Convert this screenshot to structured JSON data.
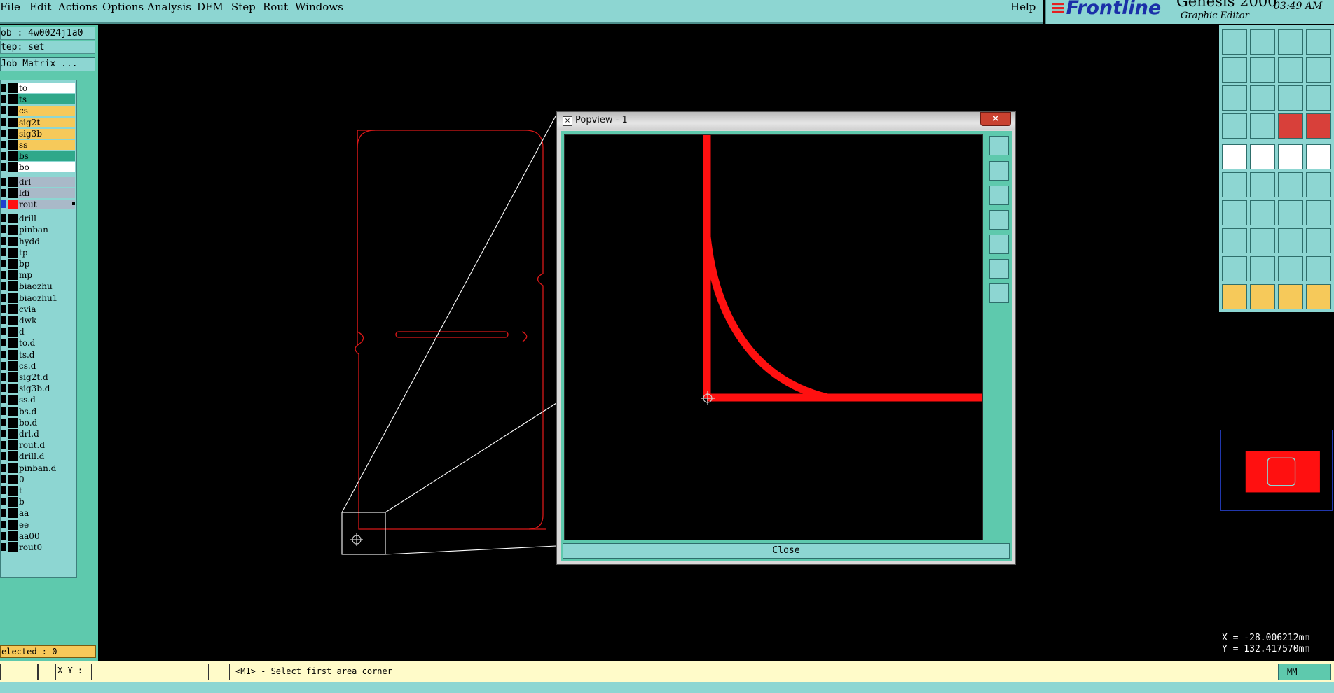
{
  "menu": {
    "items": [
      "File",
      "Edit",
      "Actions",
      "Options",
      "Analysis",
      "DFM",
      "Step",
      "Rout",
      "Windows"
    ],
    "help": "Help"
  },
  "brand": {
    "logo": "Frontline",
    "product": "Genesis 2000",
    "subtitle": "Graphic Editor",
    "clock": "03:49 AM"
  },
  "left_panel": {
    "job": "ob : 4w0024j1a0",
    "step": "tep: set",
    "matrix_button": "Job Matrix ...",
    "selected": "elected : 0"
  },
  "layers": [
    {
      "name": "to",
      "color": "#ffffff"
    },
    {
      "name": "ts",
      "color": "#2fa88a"
    },
    {
      "name": "cs",
      "color": "#f6c95a"
    },
    {
      "name": "sig2t",
      "color": "#f6c95a"
    },
    {
      "name": "sig3b",
      "color": "#f6c95a"
    },
    {
      "name": "ss",
      "color": "#f6c95a"
    },
    {
      "name": "bs",
      "color": "#2fa88a"
    },
    {
      "name": "bo",
      "color": "#ffffff"
    },
    {
      "name": "drl",
      "color": "#a9b9c8"
    },
    {
      "name": "ldi",
      "color": "#a9b9c8"
    },
    {
      "name": "rout",
      "color": "#a9b9c8",
      "active": true
    },
    {
      "name": "drill",
      "color": "#8dd6d2"
    },
    {
      "name": "pinban",
      "color": "#8dd6d2"
    },
    {
      "name": "hydd",
      "color": "#8dd6d2"
    },
    {
      "name": "tp",
      "color": "#8dd6d2"
    },
    {
      "name": "bp",
      "color": "#8dd6d2"
    },
    {
      "name": "mp",
      "color": "#8dd6d2"
    },
    {
      "name": "biaozhu",
      "color": "#8dd6d2"
    },
    {
      "name": "biaozhu1",
      "color": "#8dd6d2"
    },
    {
      "name": "cvia",
      "color": "#8dd6d2"
    },
    {
      "name": "dwk",
      "color": "#8dd6d2"
    },
    {
      "name": "d",
      "color": "#8dd6d2"
    },
    {
      "name": "to.d",
      "color": "#8dd6d2"
    },
    {
      "name": "ts.d",
      "color": "#8dd6d2"
    },
    {
      "name": "cs.d",
      "color": "#8dd6d2"
    },
    {
      "name": "sig2t.d",
      "color": "#8dd6d2"
    },
    {
      "name": "sig3b.d",
      "color": "#8dd6d2"
    },
    {
      "name": "ss.d",
      "color": "#8dd6d2"
    },
    {
      "name": "bs.d",
      "color": "#8dd6d2"
    },
    {
      "name": "bo.d",
      "color": "#8dd6d2"
    },
    {
      "name": "drl.d",
      "color": "#8dd6d2"
    },
    {
      "name": "rout.d",
      "color": "#8dd6d2"
    },
    {
      "name": "drill.d",
      "color": "#8dd6d2"
    },
    {
      "name": "pinban.d",
      "color": "#8dd6d2"
    },
    {
      "name": "0",
      "color": "#8dd6d2"
    },
    {
      "name": "t",
      "color": "#8dd6d2"
    },
    {
      "name": "b",
      "color": "#8dd6d2"
    },
    {
      "name": "aa",
      "color": "#8dd6d2"
    },
    {
      "name": "ee",
      "color": "#8dd6d2"
    },
    {
      "name": "aa00",
      "color": "#8dd6d2"
    },
    {
      "name": "rout0",
      "color": "#8dd6d2"
    }
  ],
  "popview": {
    "title": "Popview - 1",
    "close_label": "Close",
    "window_close_glyph": "✕"
  },
  "status": {
    "xy_label": "X Y :",
    "xy_value": "",
    "prompt": "<M1> - Select first area corner",
    "units": "MM"
  },
  "coords": {
    "x": "X = -28.006212mm",
    "y": "Y = 132.417570mm"
  },
  "colors": {
    "panel": "#8dd6d2",
    "panel_dark": "#5ec9ad",
    "rout_red": "#ff1010",
    "status_bg": "#fffbc9"
  }
}
